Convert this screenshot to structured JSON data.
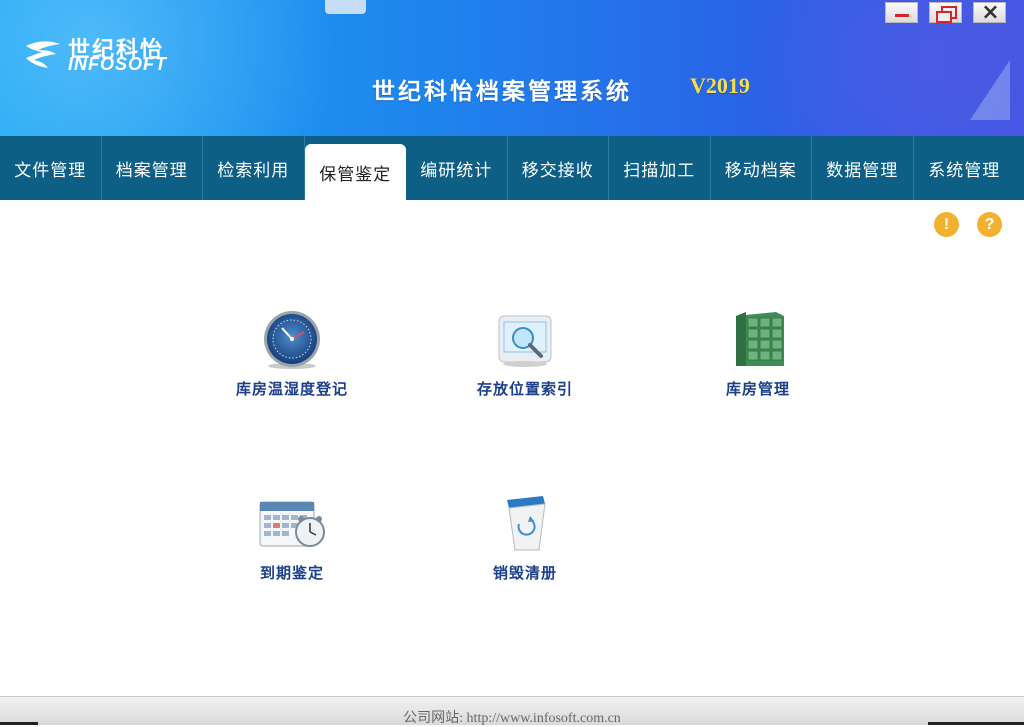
{
  "header": {
    "logo_cn": "世纪科怡",
    "logo_en": "INFOSOFT",
    "title": "世纪科怡档案管理系统",
    "version": "V2019"
  },
  "window_buttons": {
    "minimize": "minimize-icon",
    "restore": "restore-icon",
    "close": "×"
  },
  "nav": {
    "items": [
      {
        "label": "文件管理"
      },
      {
        "label": "档案管理"
      },
      {
        "label": "检索利用"
      },
      {
        "label": "保管鉴定"
      },
      {
        "label": "编研统计"
      },
      {
        "label": "移交接收"
      },
      {
        "label": "扫描加工"
      },
      {
        "label": "移动档案"
      },
      {
        "label": "数据管理"
      },
      {
        "label": "系统管理"
      }
    ],
    "active_index": 3
  },
  "toolbar": {
    "info_glyph": "!",
    "help_glyph": "?"
  },
  "modules": [
    {
      "label": "库房温湿度登记",
      "icon": "hygrometer-icon"
    },
    {
      "label": "存放位置索引",
      "icon": "monitor-search-icon"
    },
    {
      "label": "库房管理",
      "icon": "shelving-icon"
    },
    {
      "label": "到期鉴定",
      "icon": "calendar-clock-icon"
    },
    {
      "label": "销毁清册",
      "icon": "shredder-bin-icon"
    }
  ],
  "footer": {
    "text": "公司网站: http://www.infosoft.com.cn"
  },
  "colors": {
    "nav_bg": "#0e5f86",
    "header_blue": "#1e86ee",
    "version_yellow": "#f6e04a",
    "module_label": "#1c3f8c",
    "help_orange": "#f2b12e"
  }
}
